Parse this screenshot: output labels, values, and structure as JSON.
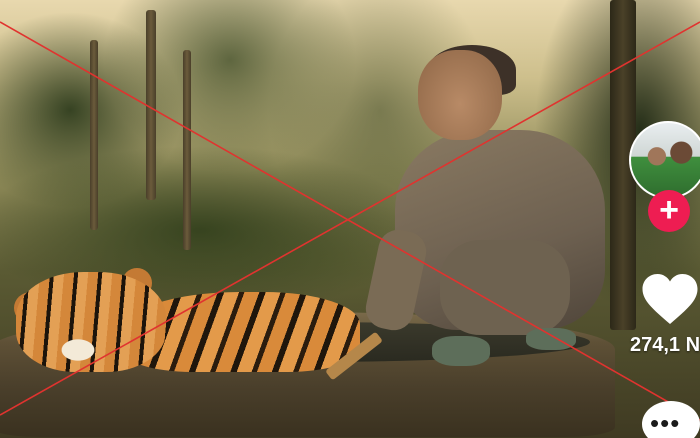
{
  "video": {
    "scene": "elderly-woman-bathing-tiger"
  },
  "overlay": {
    "cross_color": "#e0332f"
  },
  "rail": {
    "avatar": {
      "icon": "creator-avatar"
    },
    "follow_button": {
      "label": "+",
      "color": "#ee1d52"
    },
    "like_button": {
      "icon": "heart-icon"
    },
    "like_count": "274,1 N",
    "more_button": {
      "label": "•••",
      "icon": "more-dots-icon"
    }
  }
}
